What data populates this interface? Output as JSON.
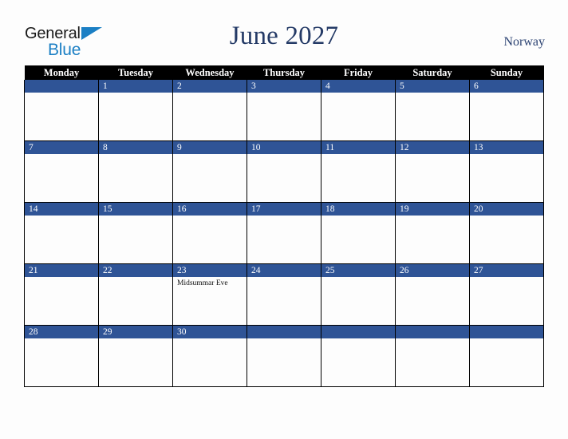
{
  "brand": {
    "name_part1": "General",
    "name_part2": "Blue",
    "triangle_icon": "triangle-icon",
    "colors": {
      "black": "#1a1a1a",
      "blue": "#1b7fc4"
    }
  },
  "header": {
    "title": "June 2027",
    "country": "Norway",
    "title_color": "#243a66",
    "country_color": "#2b4272"
  },
  "calendar": {
    "weekday_headers": [
      "Monday",
      "Tuesday",
      "Wednesday",
      "Thursday",
      "Friday",
      "Saturday",
      "Sunday"
    ],
    "header_bg": "#000000",
    "header_fg": "#ffffff",
    "daynum_bg": "#2f5496",
    "daynum_fg": "#ffffff",
    "cell_bg": "#fdfdfd",
    "grid_color": "#000000",
    "weeks": [
      [
        {
          "day": "",
          "events": []
        },
        {
          "day": "1",
          "events": []
        },
        {
          "day": "2",
          "events": []
        },
        {
          "day": "3",
          "events": []
        },
        {
          "day": "4",
          "events": []
        },
        {
          "day": "5",
          "events": []
        },
        {
          "day": "6",
          "events": []
        }
      ],
      [
        {
          "day": "7",
          "events": []
        },
        {
          "day": "8",
          "events": []
        },
        {
          "day": "9",
          "events": []
        },
        {
          "day": "10",
          "events": []
        },
        {
          "day": "11",
          "events": []
        },
        {
          "day": "12",
          "events": []
        },
        {
          "day": "13",
          "events": []
        }
      ],
      [
        {
          "day": "14",
          "events": []
        },
        {
          "day": "15",
          "events": []
        },
        {
          "day": "16",
          "events": []
        },
        {
          "day": "17",
          "events": []
        },
        {
          "day": "18",
          "events": []
        },
        {
          "day": "19",
          "events": []
        },
        {
          "day": "20",
          "events": []
        }
      ],
      [
        {
          "day": "21",
          "events": []
        },
        {
          "day": "22",
          "events": []
        },
        {
          "day": "23",
          "events": [
            "Midsummar Eve"
          ]
        },
        {
          "day": "24",
          "events": []
        },
        {
          "day": "25",
          "events": []
        },
        {
          "day": "26",
          "events": []
        },
        {
          "day": "27",
          "events": []
        }
      ],
      [
        {
          "day": "28",
          "events": []
        },
        {
          "day": "29",
          "events": []
        },
        {
          "day": "30",
          "events": []
        },
        {
          "day": "",
          "events": []
        },
        {
          "day": "",
          "events": []
        },
        {
          "day": "",
          "events": []
        },
        {
          "day": "",
          "events": []
        }
      ]
    ]
  }
}
